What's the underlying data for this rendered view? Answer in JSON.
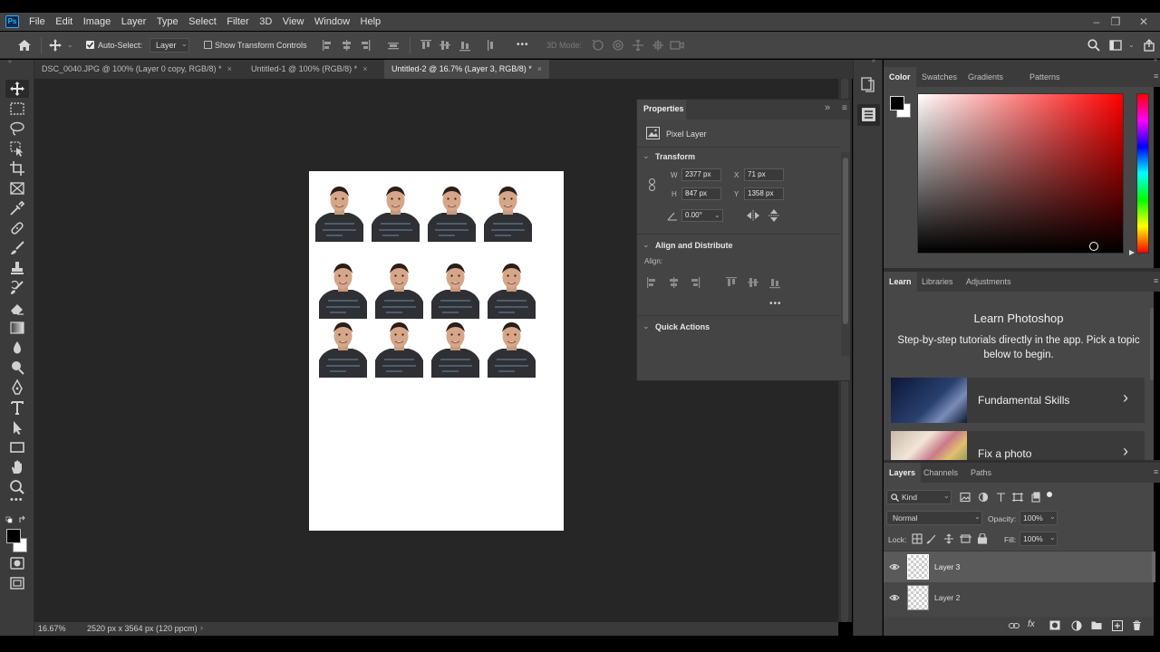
{
  "app": {
    "logo": "Ps"
  },
  "menu": [
    "File",
    "Edit",
    "Image",
    "Layer",
    "Type",
    "Select",
    "Filter",
    "3D",
    "View",
    "Window",
    "Help"
  ],
  "window_controls": {
    "minimize": "–",
    "restore": "❐",
    "close": "✕"
  },
  "options": {
    "auto_select_label": "Auto-Select:",
    "auto_select_value": "Layer",
    "show_transform": "Show Transform Controls",
    "mode_3d": "3D Mode:",
    "more": "•••"
  },
  "tabs": [
    {
      "label": "DSC_0040.JPG @ 100% (Layer 0 copy, RGB/8) *",
      "close": "×"
    },
    {
      "label": "Untitled-1 @ 100% (RGB/8) *",
      "close": "×"
    },
    {
      "label": "Untitled-2 @ 16.7% (Layer 3, RGB/8) *",
      "close": "×"
    }
  ],
  "status": {
    "zoom": "16.67%",
    "doc_size": "2520 px x 3564 px (120 ppcm)",
    "arrow": "›"
  },
  "properties": {
    "title": "Properties",
    "expand": "»",
    "kind": "Pixel Layer",
    "transform_title": "Transform",
    "w_label": "W",
    "w_value": "2377 px",
    "h_label": "H",
    "h_value": "847 px",
    "x_label": "X",
    "x_value": "71 px",
    "y_label": "Y",
    "y_value": "1358 px",
    "angle_value": "0.00°",
    "align_title": "Align and Distribute",
    "align_label": "Align:",
    "more": "•••",
    "quick_title": "Quick Actions"
  },
  "color_panel": {
    "tabs": [
      "Color",
      "Swatches",
      "Gradients",
      "Patterns"
    ],
    "foreground": "#000000",
    "background": "#ffffff",
    "hue": "#ff0000"
  },
  "learn_panel": {
    "tabs": [
      "Learn",
      "Libraries",
      "Adjustments"
    ],
    "title": "Learn Photoshop",
    "description": "Step-by-step tutorials directly in the app. Pick a topic below to begin.",
    "cards": [
      {
        "label": "Fundamental Skills",
        "arrow": "›"
      },
      {
        "label": "Fix a photo",
        "arrow": "›"
      }
    ]
  },
  "layers_panel": {
    "tabs": [
      "Layers",
      "Channels",
      "Paths"
    ],
    "kind_filter": "Kind",
    "blend_mode": "Normal",
    "opacity_label": "Opacity:",
    "opacity_value": "100%",
    "lock_label": "Lock:",
    "fill_label": "Fill:",
    "fill_value": "100%",
    "layers": [
      {
        "name": "Layer 3",
        "selected": true
      },
      {
        "name": "Layer 2",
        "selected": false
      }
    ],
    "fx": "fx"
  },
  "accent": "#31a8ff"
}
